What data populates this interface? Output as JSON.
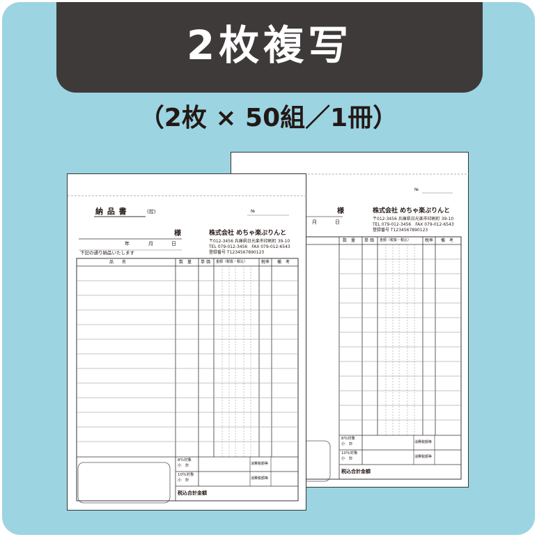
{
  "header": {
    "title": "2枚複写",
    "subtitle": "（2枚 × 50組／1冊）"
  },
  "slip": {
    "title": "納 品 書",
    "copy_label": "(控)",
    "number_label": "№",
    "honorific": "様",
    "date_year": "年",
    "date_month": "月",
    "date_day": "日",
    "delivery_note": "下記の通り納品いたします",
    "company": {
      "name": "株式会社 めちゃ楽ぷりんと",
      "address": "〒012-3456 兵庫県日光楽市印刷町 39-10",
      "tel_fax": "TEL 079-012-3456　FAX 079-012-6543",
      "registration": "登録番号 T1234567890123"
    },
    "columns": {
      "item": "品　　名",
      "qty": "数　量",
      "unit_price": "単 価",
      "amount": "金額（税抜・税込）",
      "tax_rate": "税率",
      "remarks": "備　考"
    },
    "summary": {
      "rate8_line1": "8％対象",
      "rate8_line2": "小　計",
      "rate10_line1": "10％対象",
      "rate10_line2": "小　計",
      "consumption_tax": "消費税額等",
      "total": "税込合計金額"
    }
  },
  "colors": {
    "background": "#9cd4e2",
    "header_bg": "#3e3a39",
    "header_text": "#ffffff",
    "ink": "#231815"
  }
}
